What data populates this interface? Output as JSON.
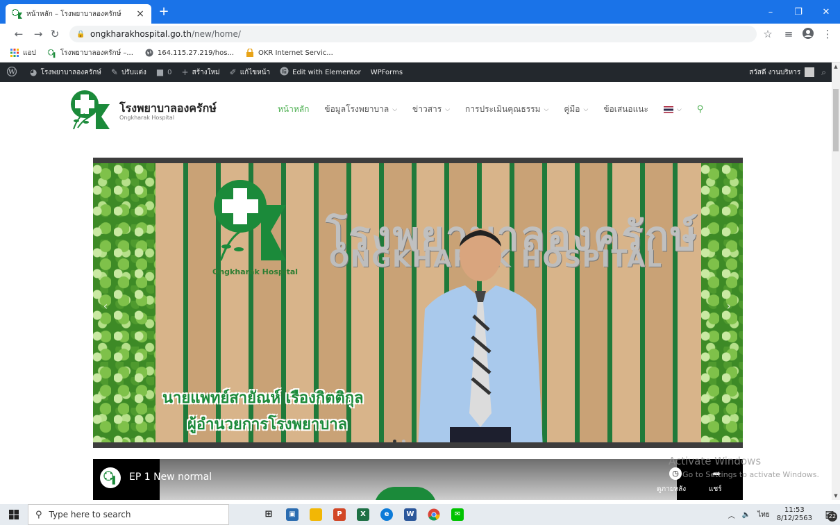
{
  "browser": {
    "tab_title": "หน้าหลัก – โรงพยาบาลองครักษ์",
    "tab_close": "×",
    "new_tab": "+",
    "url_host": "ongkharakhospital.go.th",
    "url_path": "/new/home/",
    "window_controls": {
      "minimize": "–",
      "maximize": "❐",
      "close": "✕"
    }
  },
  "bookmarks": [
    {
      "label": "แอป",
      "icon": "apps-grid-icon"
    },
    {
      "label": "โรงพยาบาลองครักษ์ –...",
      "icon": "hospital-favicon"
    },
    {
      "label": "164.115.27.219/hos...",
      "icon": "globe-icon"
    },
    {
      "label": "OKR Internet Servic...",
      "icon": "lock-folder-icon"
    }
  ],
  "adminbar": {
    "site": "โรงพยาบาลองครักษ์",
    "customize": "ปรับแต่ง",
    "comments": "0",
    "new": "สร้างใหม่",
    "edit_page": "แก้ไขหน้า",
    "elementor": "Edit with Elementor",
    "wpforms": "WPForms",
    "greeting": "สวัสดี งานบริหาร"
  },
  "site": {
    "name": "โรงพยาบาลองครักษ์",
    "subtitle": "Ongkharak Hospital",
    "nav": [
      {
        "label": "หน้าหลัก",
        "active": true,
        "dropdown": false
      },
      {
        "label": "ข้อมูลโรงพยาบาล",
        "active": false,
        "dropdown": true
      },
      {
        "label": "ข่าวสาร",
        "active": false,
        "dropdown": true
      },
      {
        "label": "การประเมินคุณธรรม",
        "active": false,
        "dropdown": true
      },
      {
        "label": "คู่มือ",
        "active": false,
        "dropdown": true
      },
      {
        "label": "ข้อเสนอแนะ",
        "active": false,
        "dropdown": false
      }
    ],
    "accent_color": "#4caf50"
  },
  "hero": {
    "logo_caption": "Ongkharak Hospital",
    "sign_thai": "โรงพยาบาลองครักษ์",
    "sign_english": "ONGKHARAK HOSPITAL",
    "caption_line1": "นายแพทย์สายัณห์ เรืองกิตติกุล",
    "caption_line2": "ผู้อำนวยการโรงพยาบาล",
    "slide_count": 2,
    "active_slide": 1
  },
  "video": {
    "title": "EP 1 New normal",
    "watch_later": "ดูภายหลัง",
    "share": "แชร์"
  },
  "watermark": {
    "line1": "Activate Windows",
    "line2": "Go to Settings to activate Windows."
  },
  "taskbar": {
    "search_placeholder": "Type here to search",
    "language": "ไทย",
    "time": "11:53",
    "date": "8/12/2563",
    "notifications": "22"
  }
}
